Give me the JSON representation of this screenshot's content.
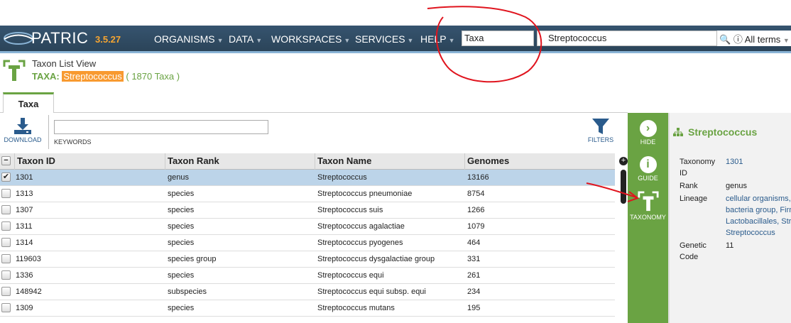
{
  "nav": {
    "logo": "PATRIC",
    "version": "3.5.27",
    "items": [
      {
        "label": "ORGANISMS"
      },
      {
        "label": "DATA"
      },
      {
        "label": "WORKSPACES"
      },
      {
        "label": "SERVICES"
      },
      {
        "label": "HELP"
      }
    ],
    "search_type": "Taxa",
    "search_value": "Streptococcus",
    "search_terms": "All terms"
  },
  "header": {
    "view_title": "Taxon List View",
    "taxa_prefix": "TAXA:",
    "taxa_name": "Streptococcus",
    "taxa_count": "( 1870 Taxa )"
  },
  "tabs": [
    {
      "label": "Taxa"
    }
  ],
  "toolbar": {
    "download_label": "DOWNLOAD",
    "keywords_label": "KEYWORDS",
    "keywords_value": "",
    "filters_label": "FILTERS"
  },
  "grid": {
    "columns": [
      "Taxon ID",
      "Taxon Rank",
      "Taxon Name",
      "Genomes"
    ],
    "rows": [
      {
        "id": "1301",
        "rank": "genus",
        "name": "Streptococcus",
        "genomes": "13166",
        "checked": true
      },
      {
        "id": "1313",
        "rank": "species",
        "name": "Streptococcus pneumoniae",
        "genomes": "8754",
        "checked": false
      },
      {
        "id": "1307",
        "rank": "species",
        "name": "Streptococcus suis",
        "genomes": "1266",
        "checked": false
      },
      {
        "id": "1311",
        "rank": "species",
        "name": "Streptococcus agalactiae",
        "genomes": "1079",
        "checked": false
      },
      {
        "id": "1314",
        "rank": "species",
        "name": "Streptococcus pyogenes",
        "genomes": "464",
        "checked": false
      },
      {
        "id": "119603",
        "rank": "species group",
        "name": "Streptococcus dysgalactiae group",
        "genomes": "331",
        "checked": false
      },
      {
        "id": "1336",
        "rank": "species",
        "name": "Streptococcus equi",
        "genomes": "261",
        "checked": false
      },
      {
        "id": "148942",
        "rank": "subspecies",
        "name": "Streptococcus equi subsp. equi",
        "genomes": "234",
        "checked": false
      },
      {
        "id": "1309",
        "rank": "species",
        "name": "Streptococcus mutans",
        "genomes": "195",
        "checked": false
      }
    ]
  },
  "sidebar": {
    "hide_label": "HIDE",
    "guide_label": "GUIDE",
    "taxonomy_label": "TAXONOMY"
  },
  "panel": {
    "title": "Streptococcus",
    "taxonomy_id_label": "Taxonomy ID",
    "taxonomy_id": "1301",
    "rank_label": "Rank",
    "rank": "genus",
    "lineage_label": "Lineage",
    "lineage": [
      "cellular organisms,",
      "bacteria group, Firm",
      "Lactobacillales, Str",
      "Streptococcus"
    ],
    "genetic_code_label": "Genetic Code",
    "genetic_code": "11"
  },
  "colors": {
    "nav_bg": "#2f4a62",
    "accent_green": "#6aa343",
    "highlight_orange": "#f89a30",
    "selected_row": "#bcd4e9",
    "annotation_red": "#e0141e"
  }
}
